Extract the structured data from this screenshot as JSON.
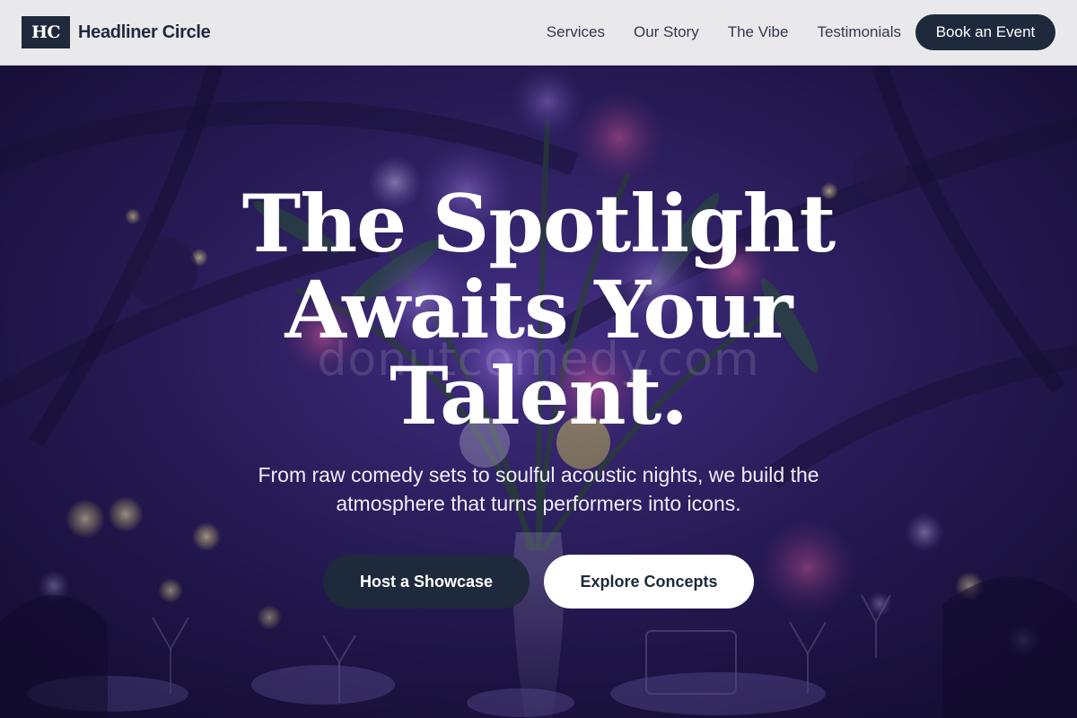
{
  "brand": {
    "logo_text": "HC",
    "name": "Headliner Circle"
  },
  "nav": {
    "links": [
      {
        "label": "Services"
      },
      {
        "label": "Our Story"
      },
      {
        "label": "The Vibe"
      },
      {
        "label": "Testimonials"
      }
    ],
    "cta_label": "Book an Event"
  },
  "hero": {
    "title_lines": [
      "The Spotlight",
      "Awaits Your",
      "Talent."
    ],
    "subtitle": "From raw comedy sets to soulful acoustic nights, we build the atmosphere that turns performers into icons.",
    "primary_button": "Host a Showcase",
    "secondary_button": "Explore Concepts",
    "watermark": "donutcomedy.com",
    "background_image": "event-table-flowers-purple-light"
  },
  "colors": {
    "nav_background": "#e9e9ec",
    "brand_dark": "#1e293b",
    "hero_tint": "#2a1f5a",
    "button_light": "#ffffff"
  }
}
